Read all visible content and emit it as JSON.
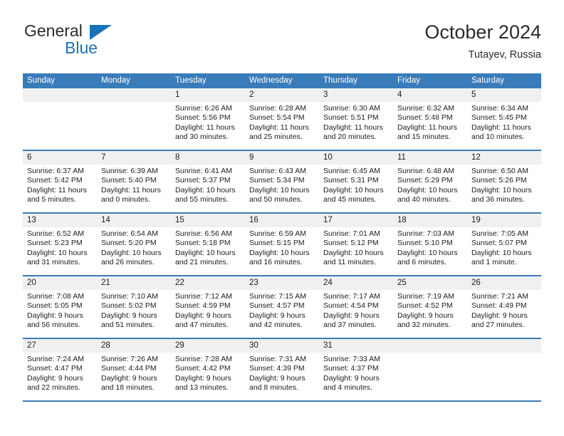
{
  "logo": {
    "word_top": "General",
    "word_bottom": "Blue",
    "triangle_icon": "triangle-icon",
    "accent_color": "#1a72b8"
  },
  "header": {
    "title": "October 2024",
    "subtitle": "Tutayev, Russia"
  },
  "theme": {
    "header_blue": "#3a7cb9",
    "daynum_band": "#f0f0f0"
  },
  "calendar": {
    "weekdays": [
      "Sunday",
      "Monday",
      "Tuesday",
      "Wednesday",
      "Thursday",
      "Friday",
      "Saturday"
    ],
    "weeks": [
      [
        {
          "day": "",
          "lines": []
        },
        {
          "day": "",
          "lines": []
        },
        {
          "day": "1",
          "lines": [
            "Sunrise: 6:26 AM",
            "Sunset: 5:56 PM",
            "Daylight: 11 hours",
            "and 30 minutes."
          ]
        },
        {
          "day": "2",
          "lines": [
            "Sunrise: 6:28 AM",
            "Sunset: 5:54 PM",
            "Daylight: 11 hours",
            "and 25 minutes."
          ]
        },
        {
          "day": "3",
          "lines": [
            "Sunrise: 6:30 AM",
            "Sunset: 5:51 PM",
            "Daylight: 11 hours",
            "and 20 minutes."
          ]
        },
        {
          "day": "4",
          "lines": [
            "Sunrise: 6:32 AM",
            "Sunset: 5:48 PM",
            "Daylight: 11 hours",
            "and 15 minutes."
          ]
        },
        {
          "day": "5",
          "lines": [
            "Sunrise: 6:34 AM",
            "Sunset: 5:45 PM",
            "Daylight: 11 hours",
            "and 10 minutes."
          ]
        }
      ],
      [
        {
          "day": "6",
          "lines": [
            "Sunrise: 6:37 AM",
            "Sunset: 5:42 PM",
            "Daylight: 11 hours",
            "and 5 minutes."
          ]
        },
        {
          "day": "7",
          "lines": [
            "Sunrise: 6:39 AM",
            "Sunset: 5:40 PM",
            "Daylight: 11 hours",
            "and 0 minutes."
          ]
        },
        {
          "day": "8",
          "lines": [
            "Sunrise: 6:41 AM",
            "Sunset: 5:37 PM",
            "Daylight: 10 hours",
            "and 55 minutes."
          ]
        },
        {
          "day": "9",
          "lines": [
            "Sunrise: 6:43 AM",
            "Sunset: 5:34 PM",
            "Daylight: 10 hours",
            "and 50 minutes."
          ]
        },
        {
          "day": "10",
          "lines": [
            "Sunrise: 6:45 AM",
            "Sunset: 5:31 PM",
            "Daylight: 10 hours",
            "and 45 minutes."
          ]
        },
        {
          "day": "11",
          "lines": [
            "Sunrise: 6:48 AM",
            "Sunset: 5:29 PM",
            "Daylight: 10 hours",
            "and 40 minutes."
          ]
        },
        {
          "day": "12",
          "lines": [
            "Sunrise: 6:50 AM",
            "Sunset: 5:26 PM",
            "Daylight: 10 hours",
            "and 36 minutes."
          ]
        }
      ],
      [
        {
          "day": "13",
          "lines": [
            "Sunrise: 6:52 AM",
            "Sunset: 5:23 PM",
            "Daylight: 10 hours",
            "and 31 minutes."
          ]
        },
        {
          "day": "14",
          "lines": [
            "Sunrise: 6:54 AM",
            "Sunset: 5:20 PM",
            "Daylight: 10 hours",
            "and 26 minutes."
          ]
        },
        {
          "day": "15",
          "lines": [
            "Sunrise: 6:56 AM",
            "Sunset: 5:18 PM",
            "Daylight: 10 hours",
            "and 21 minutes."
          ]
        },
        {
          "day": "16",
          "lines": [
            "Sunrise: 6:59 AM",
            "Sunset: 5:15 PM",
            "Daylight: 10 hours",
            "and 16 minutes."
          ]
        },
        {
          "day": "17",
          "lines": [
            "Sunrise: 7:01 AM",
            "Sunset: 5:12 PM",
            "Daylight: 10 hours",
            "and 11 minutes."
          ]
        },
        {
          "day": "18",
          "lines": [
            "Sunrise: 7:03 AM",
            "Sunset: 5:10 PM",
            "Daylight: 10 hours",
            "and 6 minutes."
          ]
        },
        {
          "day": "19",
          "lines": [
            "Sunrise: 7:05 AM",
            "Sunset: 5:07 PM",
            "Daylight: 10 hours",
            "and 1 minute."
          ]
        }
      ],
      [
        {
          "day": "20",
          "lines": [
            "Sunrise: 7:08 AM",
            "Sunset: 5:05 PM",
            "Daylight: 9 hours",
            "and 56 minutes."
          ]
        },
        {
          "day": "21",
          "lines": [
            "Sunrise: 7:10 AM",
            "Sunset: 5:02 PM",
            "Daylight: 9 hours",
            "and 51 minutes."
          ]
        },
        {
          "day": "22",
          "lines": [
            "Sunrise: 7:12 AM",
            "Sunset: 4:59 PM",
            "Daylight: 9 hours",
            "and 47 minutes."
          ]
        },
        {
          "day": "23",
          "lines": [
            "Sunrise: 7:15 AM",
            "Sunset: 4:57 PM",
            "Daylight: 9 hours",
            "and 42 minutes."
          ]
        },
        {
          "day": "24",
          "lines": [
            "Sunrise: 7:17 AM",
            "Sunset: 4:54 PM",
            "Daylight: 9 hours",
            "and 37 minutes."
          ]
        },
        {
          "day": "25",
          "lines": [
            "Sunrise: 7:19 AM",
            "Sunset: 4:52 PM",
            "Daylight: 9 hours",
            "and 32 minutes."
          ]
        },
        {
          "day": "26",
          "lines": [
            "Sunrise: 7:21 AM",
            "Sunset: 4:49 PM",
            "Daylight: 9 hours",
            "and 27 minutes."
          ]
        }
      ],
      [
        {
          "day": "27",
          "lines": [
            "Sunrise: 7:24 AM",
            "Sunset: 4:47 PM",
            "Daylight: 9 hours",
            "and 22 minutes."
          ]
        },
        {
          "day": "28",
          "lines": [
            "Sunrise: 7:26 AM",
            "Sunset: 4:44 PM",
            "Daylight: 9 hours",
            "and 18 minutes."
          ]
        },
        {
          "day": "29",
          "lines": [
            "Sunrise: 7:28 AM",
            "Sunset: 4:42 PM",
            "Daylight: 9 hours",
            "and 13 minutes."
          ]
        },
        {
          "day": "30",
          "lines": [
            "Sunrise: 7:31 AM",
            "Sunset: 4:39 PM",
            "Daylight: 9 hours",
            "and 8 minutes."
          ]
        },
        {
          "day": "31",
          "lines": [
            "Sunrise: 7:33 AM",
            "Sunset: 4:37 PM",
            "Daylight: 9 hours",
            "and 4 minutes."
          ]
        },
        {
          "day": "",
          "lines": []
        },
        {
          "day": "",
          "lines": []
        }
      ]
    ]
  }
}
